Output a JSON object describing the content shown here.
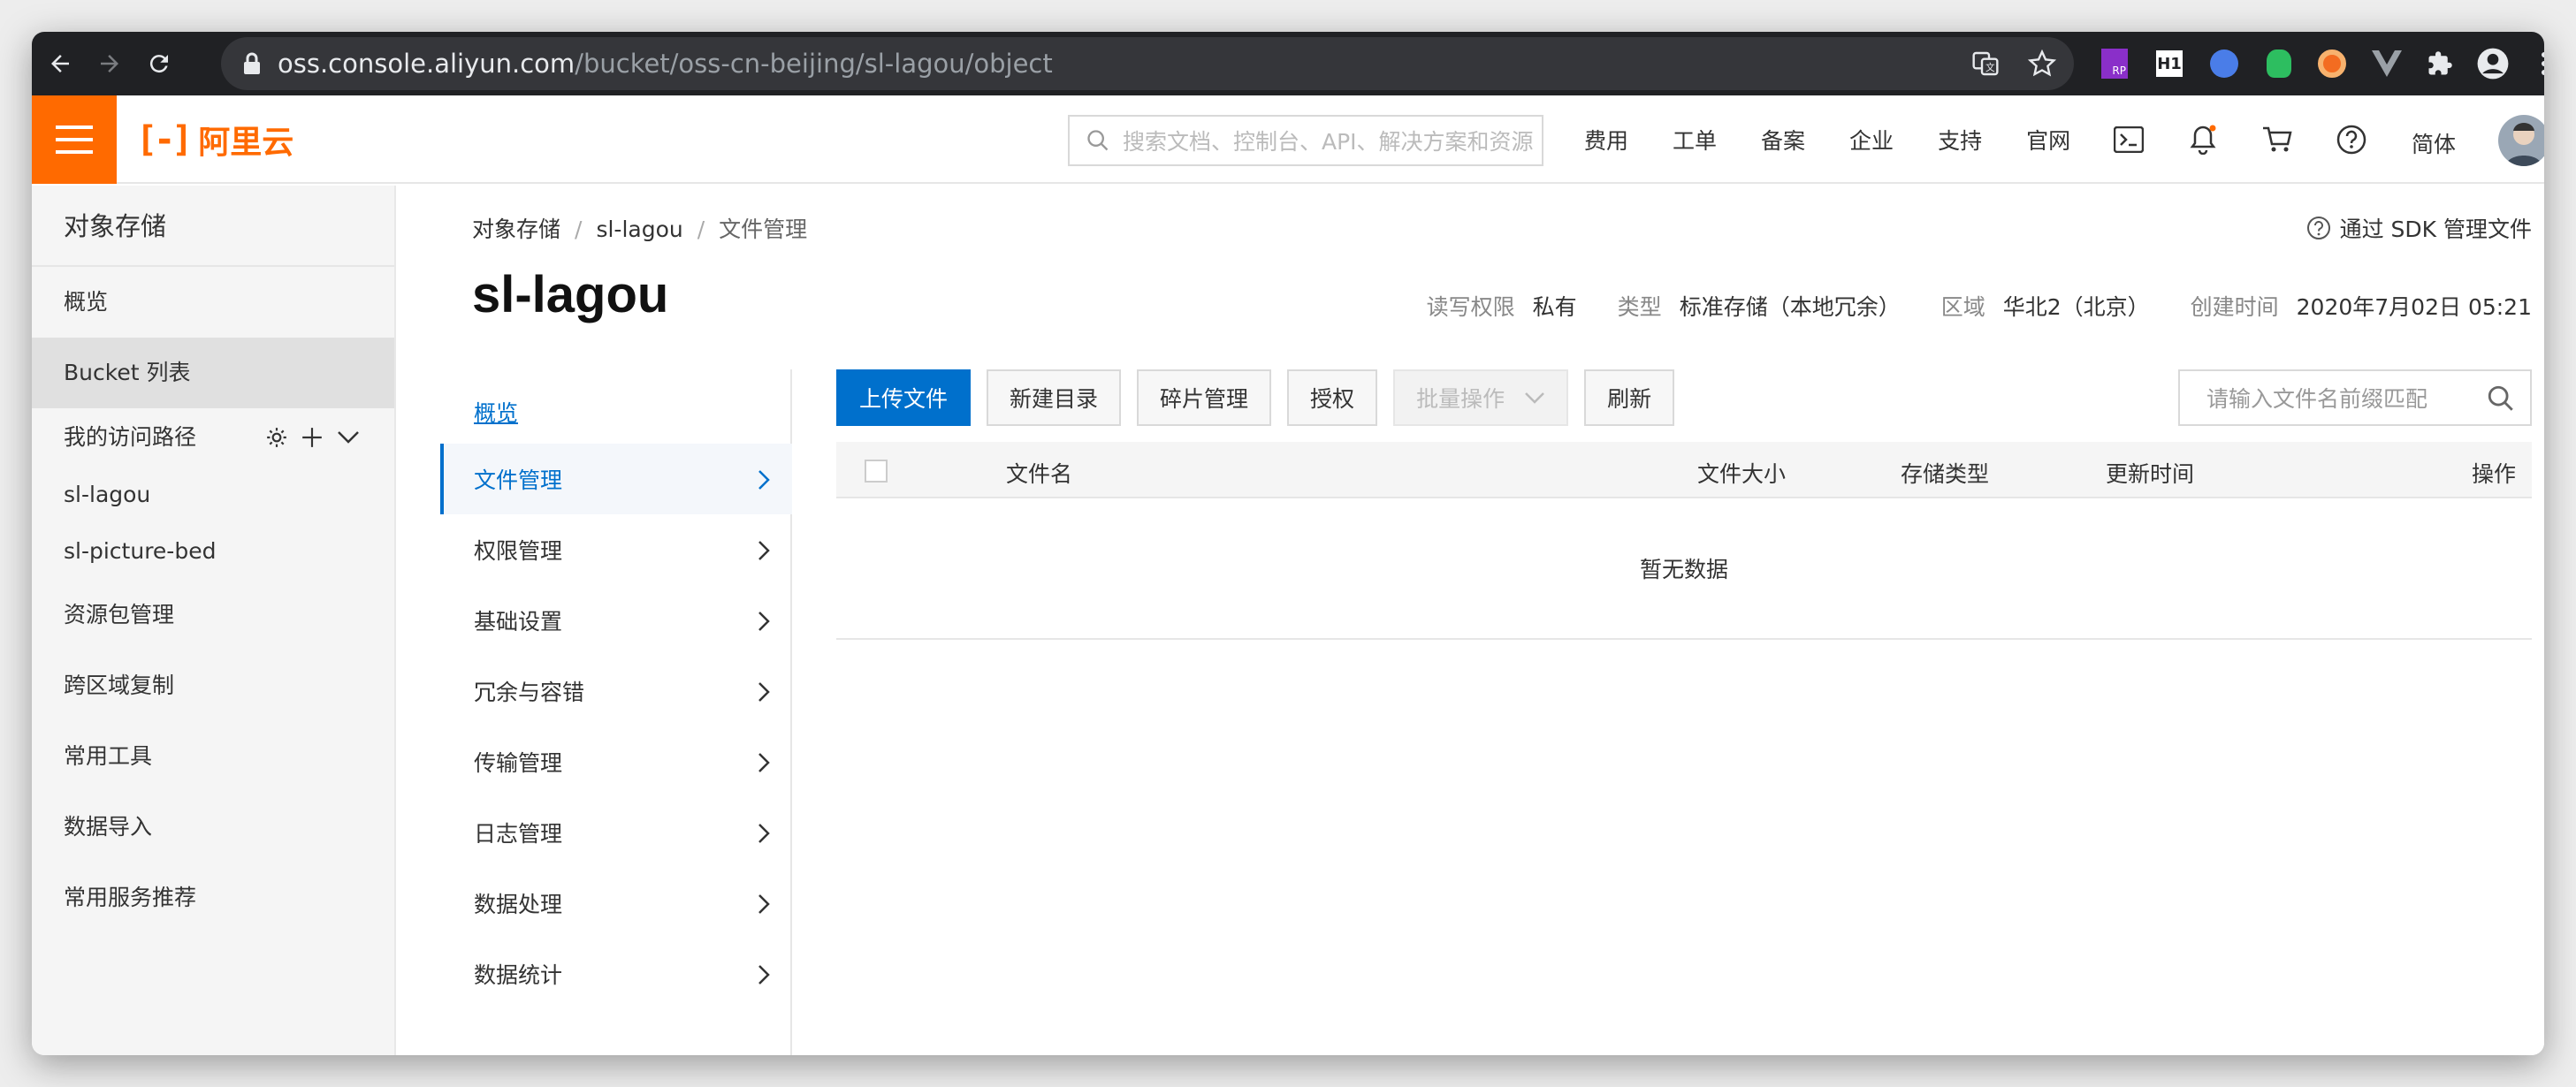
{
  "browser": {
    "url_host": "oss.console.aliyun.com",
    "url_path": "/bucket/oss-cn-beijing/sl-lagou/object",
    "extensions": [
      "rp-icon",
      "h1-icon",
      "check-icon",
      "evernote-icon",
      "target-icon",
      "vue-icon",
      "puzzle-icon",
      "profile-icon",
      "menu-dots-icon"
    ]
  },
  "header": {
    "logo_mark": "[-]",
    "logo_text": "阿里云",
    "search_placeholder": "搜索文档、控制台、API、解决方案和资源",
    "nav": [
      "费用",
      "工单",
      "备案",
      "企业",
      "支持",
      "官网"
    ],
    "lang": "简体",
    "brand_color": "#ff6a00"
  },
  "sidebar": {
    "title": "对象存储",
    "overview": "概览",
    "bucket_list": "Bucket 列表",
    "paths_header": "我的访问路径",
    "paths": [
      "sl-lagou",
      "sl-picture-bed"
    ],
    "items": [
      "资源包管理",
      "跨区域复制",
      "常用工具",
      "数据导入",
      "常用服务推荐"
    ]
  },
  "main": {
    "breadcrumb": [
      "对象存储",
      "sl-lagou",
      "文件管理"
    ],
    "sdk_link": "通过 SDK 管理文件",
    "bucket_name": "sl-lagou",
    "meta": {
      "acl_label": "读写权限",
      "acl_value": "私有",
      "type_label": "类型",
      "type_value": "标准存储（本地冗余）",
      "region_label": "区域",
      "region_value": "华北2（北京）",
      "created_label": "创建时间",
      "created_value": "2020年7月02日 05:21"
    },
    "subnav": {
      "overview": "概览",
      "items": [
        "文件管理",
        "权限管理",
        "基础设置",
        "冗余与容错",
        "传输管理",
        "日志管理",
        "数据处理",
        "数据统计"
      ]
    },
    "toolbar": {
      "upload": "上传文件",
      "new_dir": "新建目录",
      "fragments": "碎片管理",
      "authorize": "授权",
      "batch": "批量操作",
      "refresh": "刷新",
      "search_placeholder": "请输入文件名前缀匹配"
    },
    "table": {
      "columns": [
        "文件名",
        "文件大小",
        "存储类型",
        "更新时间",
        "操作"
      ],
      "empty_text": "暂无数据"
    },
    "accent_color": "#0070cc"
  }
}
